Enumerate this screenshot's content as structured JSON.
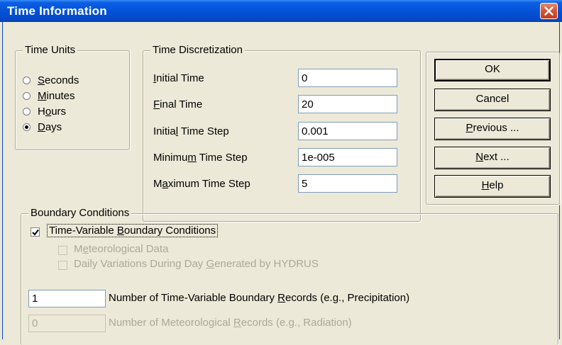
{
  "window": {
    "title": "Time Information"
  },
  "time_units": {
    "legend": "Time Units",
    "options": [
      {
        "pre": "",
        "ul": "S",
        "post": "econds",
        "checked": false
      },
      {
        "pre": "",
        "ul": "M",
        "post": "inutes",
        "checked": false
      },
      {
        "pre": "H",
        "ul": "o",
        "post": "urs",
        "checked": false
      },
      {
        "pre": "",
        "ul": "D",
        "post": "ays",
        "checked": true
      }
    ]
  },
  "time_discretization": {
    "legend": "Time Discretization",
    "fields": [
      {
        "pre": "",
        "ul": "I",
        "post": "nitial Time",
        "value": "0"
      },
      {
        "pre": "",
        "ul": "F",
        "post": "inal Time",
        "value": "20"
      },
      {
        "pre": "Initia",
        "ul": "l",
        "post": " Time Step",
        "value": "0.001"
      },
      {
        "pre": "Minimu",
        "ul": "m",
        "post": " Time Step",
        "value": "1e-005"
      },
      {
        "pre": "M",
        "ul": "a",
        "post": "ximum Time Step",
        "value": "5"
      }
    ]
  },
  "buttons": {
    "ok": {
      "pre": "OK",
      "ul": "",
      "post": ""
    },
    "cancel": {
      "pre": "Cancel",
      "ul": "",
      "post": ""
    },
    "previous": {
      "pre": "",
      "ul": "P",
      "post": "revious ..."
    },
    "next": {
      "pre": "",
      "ul": "N",
      "post": "ext ..."
    },
    "help": {
      "pre": "",
      "ul": "H",
      "post": "elp"
    }
  },
  "boundary_conditions": {
    "legend": "Boundary Conditions",
    "time_variable": {
      "pre": "Time-Variable ",
      "ul": "B",
      "post": "oundary Conditions",
      "checked": true
    },
    "meteorological": {
      "pre": "M",
      "ul": "e",
      "post": "teorological Data",
      "checked": false
    },
    "daily_variations": {
      "pre": "Daily Variations During Day ",
      "ul": "G",
      "post": "enerated by HYDRUS",
      "checked": false
    },
    "records": {
      "value": "1",
      "pre": "Number of Time-Variable Boundary ",
      "ul": "R",
      "post": "ecords (e.g., Precipitation)"
    },
    "meteo_records": {
      "value": "0",
      "pre": "Number of Meteorological ",
      "ul": "R",
      "post": "ecords (e.g., Radiation)"
    }
  }
}
